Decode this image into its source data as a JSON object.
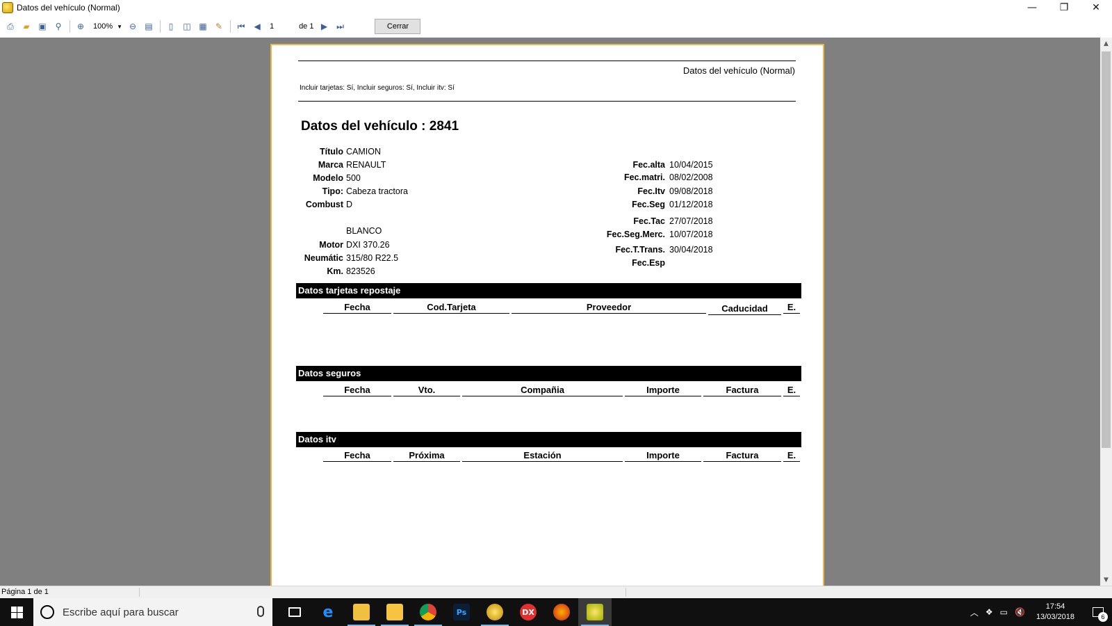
{
  "window": {
    "title": "Datos del vehículo (Normal)",
    "minimize": "—",
    "restore": "❐",
    "close": "✕"
  },
  "toolbar": {
    "zoom": "100%",
    "page_value": "1",
    "page_of": "de 1",
    "close_label": "Cerrar"
  },
  "report": {
    "header_title": "Datos del vehículo (Normal)",
    "filters": "Incluir tarjetas: Sí, Incluir seguros: Sí, Incluir itv: Sí",
    "heading": "Datos del vehículo : 2841",
    "left_fields": [
      {
        "label": "Título",
        "value": "CAMION"
      },
      {
        "label": "Marca",
        "value": "RENAULT"
      },
      {
        "label": "Modelo",
        "value": "500"
      },
      {
        "label": "Tipo:",
        "value": "Cabeza tractora"
      },
      {
        "label": "Combust",
        "value": "D"
      },
      {
        "label": "",
        "value": "BLANCO"
      },
      {
        "label": "Motor",
        "value": "DXI 370.26"
      },
      {
        "label": "Neumátic",
        "value": "315/80 R22.5"
      },
      {
        "label": "Km.",
        "value": "823526"
      }
    ],
    "right_fields": [
      {
        "label": "Fec.alta",
        "value": "10/04/2015"
      },
      {
        "label": "Fec.matri.",
        "value": "08/02/2008"
      },
      {
        "label": "Fec.Itv",
        "value": "09/08/2018"
      },
      {
        "label": "Fec.Seg",
        "value": "01/12/2018"
      },
      {
        "label": "Fec.Tac",
        "value": "27/07/2018"
      },
      {
        "label": "Fec.Seg.Merc.",
        "value": "10/07/2018"
      },
      {
        "label": "Fec.T.Trans.",
        "value": "30/04/2018"
      },
      {
        "label": "Fec.Esp",
        "value": ""
      }
    ],
    "sections": [
      {
        "title": "Datos tarjetas repostaje",
        "columns": [
          "Fecha",
          "Cod.Tarjeta",
          "Proveedor",
          "Caducidad",
          "E."
        ]
      },
      {
        "title": "Datos seguros",
        "columns": [
          "Fecha",
          "Vto.",
          "Compañia",
          "Importe",
          "Factura",
          "E."
        ]
      },
      {
        "title": "Datos itv",
        "columns": [
          "Fecha",
          "Próxima",
          "Estación",
          "Importe",
          "Factura",
          "E."
        ]
      }
    ]
  },
  "status": {
    "page_text": "Página 1 de 1"
  },
  "taskbar": {
    "search_placeholder": "Escribe aquí para buscar",
    "time": "17:54",
    "date": "13/03/2018",
    "notifications": "6"
  }
}
